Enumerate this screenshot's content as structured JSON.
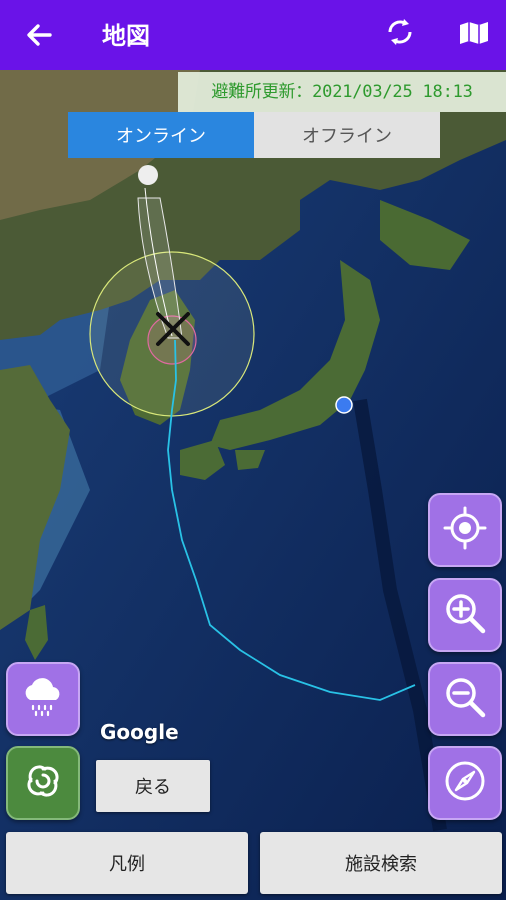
{
  "appbar": {
    "title": "地図"
  },
  "banner": {
    "label": "避難所更新：",
    "datetime": "2021/03/25 18:13"
  },
  "mode_toggle": {
    "online": "オンライン",
    "offline": "オフライン",
    "selected": "online"
  },
  "map": {
    "attribution": "Google",
    "typhoon_track_color": "#29c2e6",
    "location_dot_color": "#3b7bf0"
  },
  "controls": {
    "back_label": "戻る"
  },
  "footer": {
    "legend_label": "凡例",
    "facility_search_label": "施設検索"
  },
  "icons": [
    "back-arrow-icon",
    "refresh-icon",
    "map-book-icon",
    "rain-cloud-icon",
    "typhoon-swirl-icon",
    "my-location-icon",
    "zoom-in-icon",
    "zoom-out-icon",
    "compass-icon"
  ],
  "colors": {
    "appbar": "#6a13e8",
    "fab": "#a071e6",
    "fab_green": "#4c8a3e",
    "banner_text": "#2e9a2e",
    "toggle_active": "#2a86df"
  }
}
